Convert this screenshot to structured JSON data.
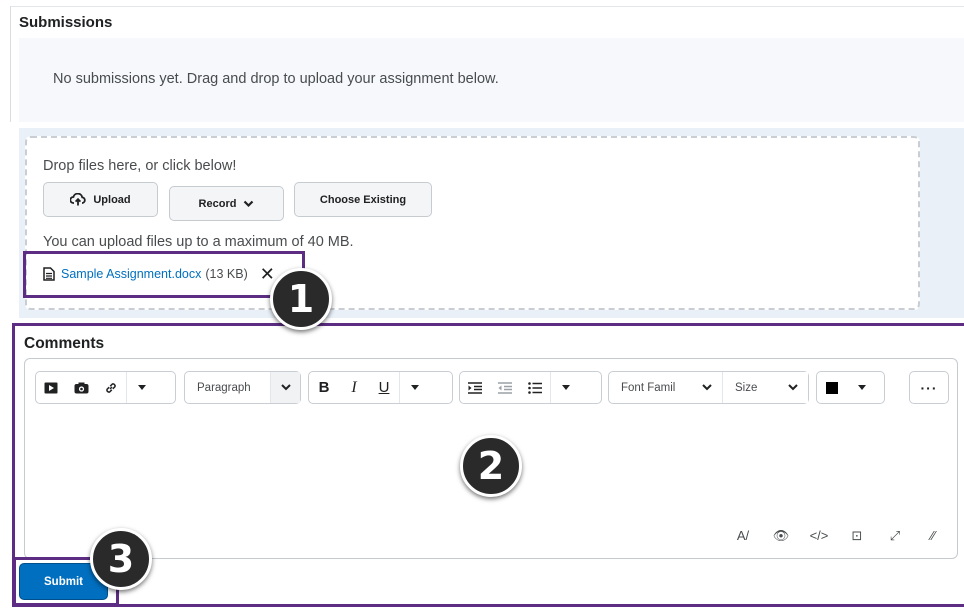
{
  "submissions": {
    "title": "Submissions",
    "empty_message": "No submissions yet. Drag and drop to upload your assignment below."
  },
  "dropzone": {
    "hint": "Drop files here, or click below!",
    "upload_label": "Upload",
    "record_label": "Record",
    "choose_existing_label": "Choose Existing",
    "size_note": "You can upload files up to a maximum of 40 MB.",
    "file": {
      "name": "Sample Assignment.docx",
      "size": "(13 KB)"
    }
  },
  "comments": {
    "title": "Comments",
    "paragraph_select": "Paragraph",
    "font_family_select": "Font Famil",
    "size_select": "Size"
  },
  "callouts": {
    "one": "1",
    "two": "2",
    "three": "3"
  },
  "submit_label": "Submit",
  "colors": {
    "callout": "#5c2d82",
    "submit": "#006fbf",
    "link": "#006fbf"
  }
}
